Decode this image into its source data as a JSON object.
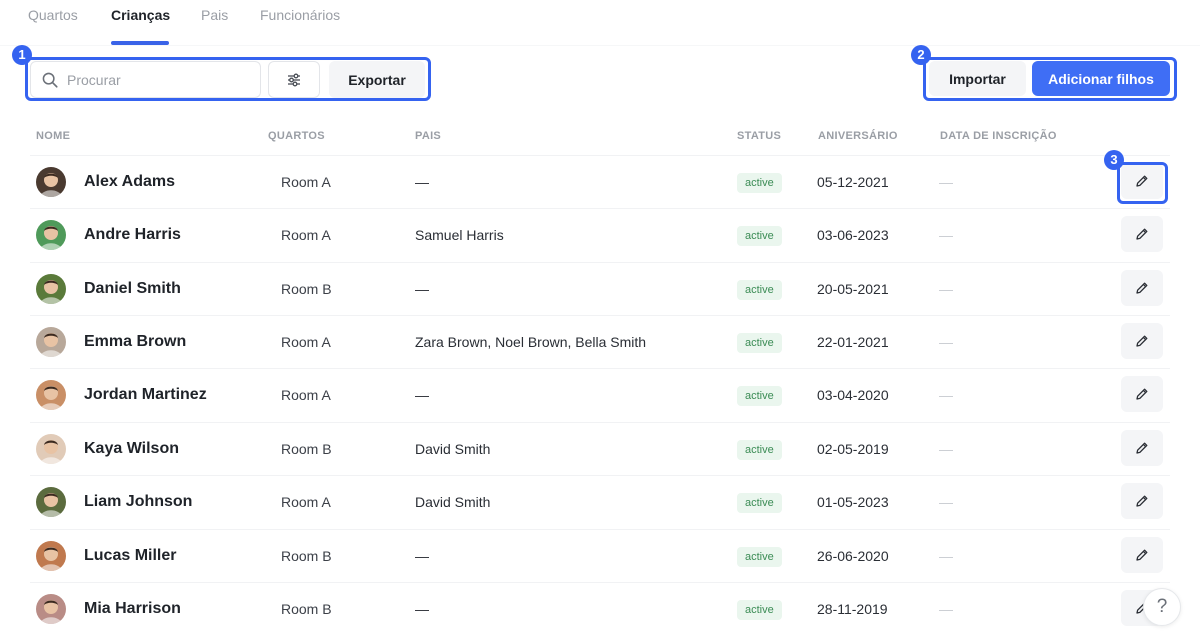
{
  "tabs": [
    {
      "label": "Quartos",
      "active": false
    },
    {
      "label": "Crianças",
      "active": true
    },
    {
      "label": "Pais",
      "active": false
    },
    {
      "label": "Funcionários",
      "active": false
    }
  ],
  "toolbar": {
    "search_placeholder": "Procurar",
    "search_value": "",
    "export_label": "Exportar",
    "import_label": "Importar",
    "add_label": "Adicionar filhos"
  },
  "annotations": {
    "box1": "1",
    "box2": "2",
    "box3": "3"
  },
  "table": {
    "headers": {
      "name": "NOME",
      "rooms": "QUARTOS",
      "parents": "PAIS",
      "status": "STATUS",
      "birthday": "ANIVERSÁRIO",
      "enrollment": "DATA DE INSCRIÇÃO"
    },
    "rows": [
      {
        "name": "Alex Adams",
        "room": "Room A",
        "parents": "—",
        "status": "active",
        "birthday": "05-12-2021",
        "enrollment": "—",
        "avatar_color": "#4a3a30"
      },
      {
        "name": "Andre Harris",
        "room": "Room A",
        "parents": "Samuel Harris",
        "status": "active",
        "birthday": "03-06-2023",
        "enrollment": "—",
        "avatar_color": "#4f9a5a"
      },
      {
        "name": "Daniel Smith",
        "room": "Room B",
        "parents": "—",
        "status": "active",
        "birthday": "20-05-2021",
        "enrollment": "—",
        "avatar_color": "#5a7a3a"
      },
      {
        "name": "Emma Brown",
        "room": "Room A",
        "parents": "Zara Brown, Noel Brown, Bella Smith",
        "status": "active",
        "birthday": "22-01-2021",
        "enrollment": "—",
        "avatar_color": "#b8a89a"
      },
      {
        "name": "Jordan Martinez",
        "room": "Room A",
        "parents": "—",
        "status": "active",
        "birthday": "03-04-2020",
        "enrollment": "—",
        "avatar_color": "#c98f66"
      },
      {
        "name": "Kaya Wilson",
        "room": "Room B",
        "parents": "David Smith",
        "status": "active",
        "birthday": "02-05-2019",
        "enrollment": "—",
        "avatar_color": "#e1cbb8"
      },
      {
        "name": "Liam Johnson",
        "room": "Room A",
        "parents": "David Smith",
        "status": "active",
        "birthday": "01-05-2023",
        "enrollment": "—",
        "avatar_color": "#5b6b3e"
      },
      {
        "name": "Lucas Miller",
        "room": "Room B",
        "parents": "—",
        "status": "active",
        "birthday": "26-06-2020",
        "enrollment": "—",
        "avatar_color": "#c0794e"
      },
      {
        "name": "Mia Harrison",
        "room": "Room B",
        "parents": "—",
        "status": "active",
        "birthday": "28-11-2019",
        "enrollment": "—",
        "avatar_color": "#b98c86"
      }
    ]
  },
  "help": {
    "label": "?"
  },
  "colors": {
    "accent": "#3563f0",
    "primary_button": "#3f6ef5",
    "status_bg": "#eaf6ee",
    "status_text": "#3b8c55"
  },
  "icons": {
    "search": "search-icon",
    "filter": "sliders-icon",
    "edit": "pencil-icon",
    "help": "question-icon"
  }
}
